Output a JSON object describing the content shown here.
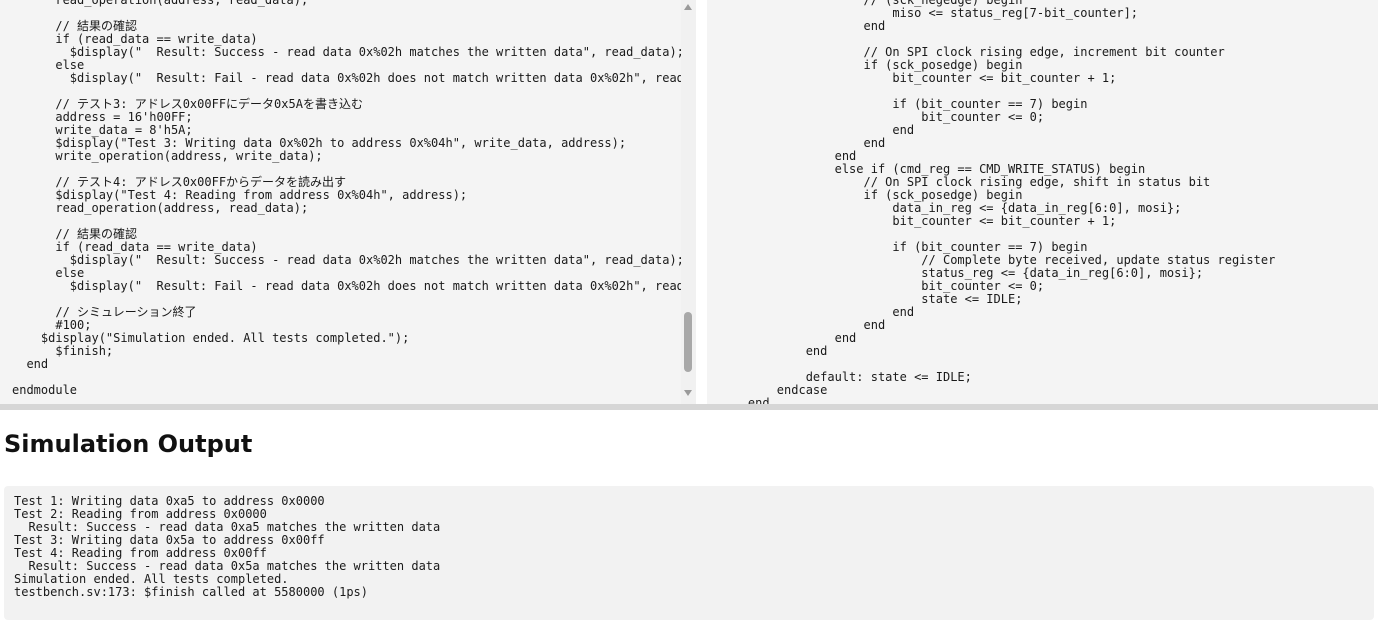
{
  "editor": {
    "left_code": "      read_operation(address, read_data);\n\n      // 結果の確認\n      if (read_data == write_data)\n        $display(\"  Result: Success - read data 0x%02h matches the written data\", read_data);\n      else\n        $display(\"  Result: Fail - read data 0x%02h does not match written data 0x%02h\", read_data, \n\n      // テスト3: アドレス0x00FFにデータ0x5Aを書き込む\n      address = 16'h00FF;\n      write_data = 8'h5A;\n      $display(\"Test 3: Writing data 0x%02h to address 0x%04h\", write_data, address);\n      write_operation(address, write_data);\n\n      // テスト4: アドレス0x00FFからデータを読み出す\n      $display(\"Test 4: Reading from address 0x%04h\", address);\n      read_operation(address, read_data);\n\n      // 結果の確認\n      if (read_data == write_data)\n        $display(\"  Result: Success - read data 0x%02h matches the written data\", read_data);\n      else\n        $display(\"  Result: Fail - read data 0x%02h does not match written data 0x%02h\", read_data, \n\n      // シミュレーション終了\n      #100;\n    $display(\"Simulation ended. All tests completed.\");\n      $finish;\n  end\n\nendmodule",
    "right_code": "                    // (sck_negedge) begin\n                        miso <= status_reg[7-bit_counter];\n                    end\n\n                    // On SPI clock rising edge, increment bit counter\n                    if (sck_posedge) begin\n                        bit_counter <= bit_counter + 1;\n\n                        if (bit_counter == 7) begin\n                            bit_counter <= 0;\n                        end\n                    end\n                end\n                else if (cmd_reg == CMD_WRITE_STATUS) begin\n                    // On SPI clock rising edge, shift in status bit\n                    if (sck_posedge) begin\n                        data_in_reg <= {data_in_reg[6:0], mosi};\n                        bit_counter <= bit_counter + 1;\n\n                        if (bit_counter == 7) begin\n                            // Complete byte received, update status register\n                            status_reg <= {data_in_reg[6:0], mosi};\n                            bit_counter <= 0;\n                            state <= IDLE;\n                        end\n                    end\n                end\n            end\n\n            default: state <= IDLE;\n        endcase\n    end"
  },
  "output": {
    "title": "Simulation Output",
    "text": "Test 1: Writing data 0xa5 to address 0x0000\nTest 2: Reading from address 0x0000\n  Result: Success - read data 0xa5 matches the written data\nTest 3: Writing data 0x5a to address 0x00ff\nTest 4: Reading from address 0x00ff\n  Result: Success - read data 0x5a matches the written data\nSimulation ended. All tests completed.\ntestbench.sv:173: $finish called at 5580000 (1ps)"
  },
  "colors": {
    "code_background": "#f4f4f4",
    "page_background": "#ffffff",
    "scrollbar_thumb": "#a8a8a8"
  },
  "icons": {
    "scroll_up": "scroll-up-arrow-icon",
    "scroll_down": "scroll-down-arrow-icon"
  }
}
